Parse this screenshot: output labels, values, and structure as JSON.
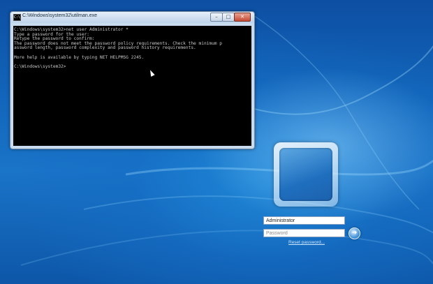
{
  "console_window": {
    "title": "C:\\Windows\\system32\\utilman.exe",
    "buttons": {
      "minimize": "–",
      "maximize": "□",
      "close": "✕"
    },
    "icon_text": "C:\\",
    "output": "C:\\Windows\\system32>net user Administrator *\nType a password for the user:\nRetype the password to confirm:\nThe password does not meet the password policy requirements. Check the minimum p\nassword length, password complexity and password history requirements.\n\nMore help is available by typing NET HELPMSG 2245.\n\nC:\\Windows\\system32>"
  },
  "logon": {
    "username_value": "Administrator",
    "password_placeholder": "Password",
    "submit_icon": "arrow-right",
    "reset_link": "Reset password..."
  }
}
